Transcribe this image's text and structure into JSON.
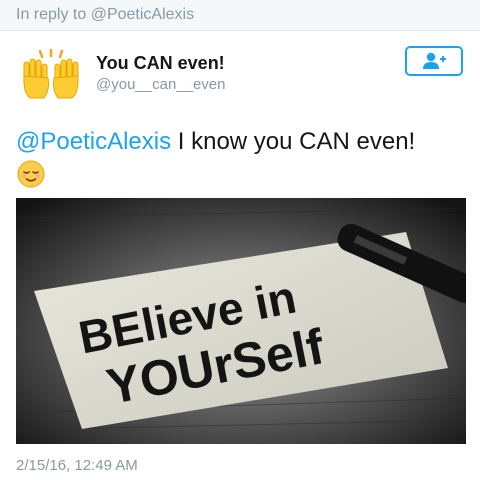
{
  "reply": {
    "text": "In reply to @PoeticAlexis"
  },
  "author": {
    "display_name": "You CAN even!",
    "handle": "@you__can__even",
    "avatar_icon": "raising-hands-emoji-icon"
  },
  "follow_button": {
    "icon": "add-user-icon",
    "color": "#1da1f2"
  },
  "tweet": {
    "mention": "@PoeticAlexis",
    "text": " I know you CAN even!",
    "emoji_icon": "relieved-face-emoji-icon"
  },
  "media": {
    "note_line1": "BElieve in",
    "note_line2": "YOUrSelf"
  },
  "timestamp": "2/15/16, 12:49 AM",
  "colors": {
    "link": "#1da1f2",
    "muted": "#8899a6",
    "text": "#14171a"
  }
}
